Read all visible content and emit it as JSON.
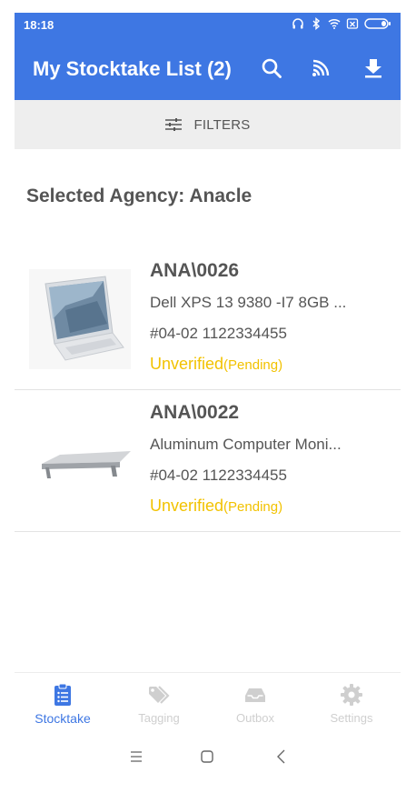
{
  "status_bar": {
    "time": "18:18"
  },
  "app_bar": {
    "title": "My Stocktake List (2)"
  },
  "filters": {
    "label": "FILTERS"
  },
  "agency": {
    "label": "Selected Agency: Anacle"
  },
  "items": [
    {
      "code": "ANA\\0026",
      "description": "Dell XPS 13 9380 -I7 8GB ...",
      "location": "#04-02 1122334455",
      "status": "Unverified",
      "sub_status": "(Pending)"
    },
    {
      "code": "ANA\\0022",
      "description": "Aluminum Computer Moni...",
      "location": "#04-02 1122334455",
      "status": "Unverified",
      "sub_status": "(Pending)"
    }
  ],
  "bottom_nav": {
    "items": [
      {
        "label": "Stocktake",
        "icon": "clipboard-list-icon",
        "active": true
      },
      {
        "label": "Tagging",
        "icon": "tags-icon",
        "active": false
      },
      {
        "label": "Outbox",
        "icon": "inbox-tray-icon",
        "active": false
      },
      {
        "label": "Settings",
        "icon": "gear-icon",
        "active": false
      }
    ]
  },
  "colors": {
    "primary": "#3e77e3",
    "status_warning": "#f2c200",
    "text": "#555555",
    "filter_bar": "#eeeeee",
    "nav_inactive": "#cfcfcf"
  }
}
